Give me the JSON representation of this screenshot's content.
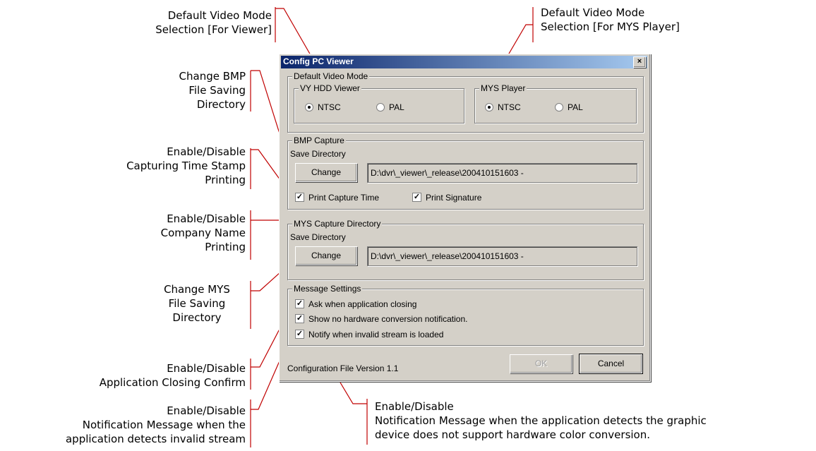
{
  "annotations": {
    "default_video_viewer": [
      "Default  Video Mode",
      "Selection [For Viewer]"
    ],
    "default_video_mys": [
      "Default  Video Mode",
      "Selection [For MYS Player]"
    ],
    "change_bmp": [
      "Change BMP",
      "File Saving",
      "Directory"
    ],
    "capture_time": [
      "Enable/Disable",
      "Capturing Time Stamp",
      "Printing"
    ],
    "company_name": [
      "Enable/Disable",
      "Company Name",
      "Printing"
    ],
    "change_mys": [
      "Change MYS",
      "File Saving",
      "Directory"
    ],
    "app_closing": [
      "Enable/Disable",
      "Application Closing Confirm"
    ],
    "invalid_stream": [
      "Enable/Disable",
      "Notification Message when the",
      "application detects invalid stream"
    ],
    "hw_conversion": [
      "Enable/Disable",
      "Notification Message when the application detects the graphic",
      "device does not support hardware color conversion."
    ]
  },
  "dialog": {
    "title": "Config PC Viewer",
    "close_label": "×",
    "default_video_mode": {
      "legend": "Default Video Mode",
      "viewer": {
        "legend": "VY HDD Viewer",
        "ntsc": "NTSC",
        "pal": "PAL",
        "selected": "NTSC"
      },
      "mys": {
        "legend": "MYS Player",
        "ntsc": "NTSC",
        "pal": "PAL",
        "selected": "NTSC"
      }
    },
    "bmp_capture": {
      "legend": "BMP Capture",
      "save_dir_label": "Save Directory",
      "change_label": "Change",
      "path": "D:\\dvr\\_viewer\\_release\\200410151603 -",
      "print_capture_time": {
        "label": "Print Capture Time",
        "checked": true
      },
      "print_signature": {
        "label": "Print Signature",
        "checked": true
      }
    },
    "mys_capture": {
      "legend": "MYS Capture Directory",
      "save_dir_label": "Save Directory",
      "change_label": "Change",
      "path": "D:\\dvr\\_viewer\\_release\\200410151603 -"
    },
    "message_settings": {
      "legend": "Message Settings",
      "items": [
        {
          "label": "Ask when application closing",
          "checked": true
        },
        {
          "label": "Show no hardware conversion notification.",
          "checked": true
        },
        {
          "label": "Notify when invalid stream is loaded",
          "checked": true
        }
      ]
    },
    "footer": {
      "version_text": "Configuration File Version 1.1",
      "ok_label": "OK",
      "cancel_label": "Cancel"
    }
  }
}
